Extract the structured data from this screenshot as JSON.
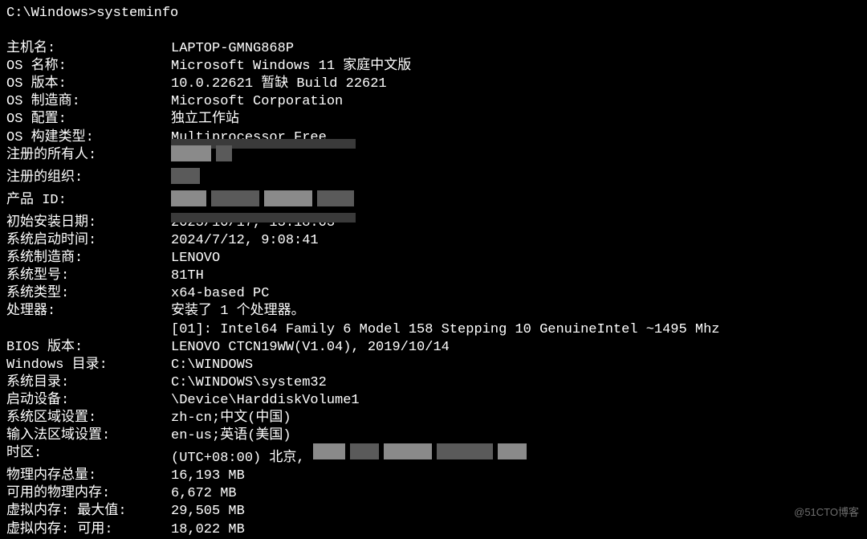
{
  "prompt": "C:\\Windows>systeminfo",
  "rows": [
    {
      "label": "主机名:",
      "value": "LAPTOP-GMNG868P"
    },
    {
      "label": "OS 名称:",
      "value": "Microsoft Windows 11 家庭中文版"
    },
    {
      "label": "OS 版本:",
      "value": "10.0.22621 暂缺 Build 22621"
    },
    {
      "label": "OS 制造商:",
      "value": "Microsoft Corporation"
    },
    {
      "label": "OS 配置:",
      "value": "独立工作站"
    },
    {
      "label": "OS 构建类型:",
      "value": "Multiprocessor Free",
      "overlay": "top-strip"
    },
    {
      "label": "注册的所有人:",
      "value": "",
      "redacted": "owner"
    },
    {
      "label": "注册的组织:",
      "value": "",
      "redacted": "org"
    },
    {
      "label": "产品 ID:",
      "value": "",
      "redacted": "product"
    },
    {
      "label": "初始安装日期:",
      "value": "2023/10/17, 13:18:03",
      "overlay": "bottom-strip"
    },
    {
      "label": "系统启动时间:",
      "value": "2024/7/12, 9:08:41"
    },
    {
      "label": "系统制造商:",
      "value": "LENOVO"
    },
    {
      "label": "系统型号:",
      "value": "81TH"
    },
    {
      "label": "系统类型:",
      "value": "x64-based PC"
    },
    {
      "label": "处理器:",
      "value": "安装了 1 个处理器。"
    },
    {
      "label": "",
      "value": "[01]: Intel64 Family 6 Model 158 Stepping 10 GenuineIntel ~1495 Mhz",
      "indent": true
    },
    {
      "label": "BIOS 版本:",
      "value": "LENOVO CTCN19WW(V1.04), 2019/10/14"
    },
    {
      "label": "Windows 目录:",
      "value": "C:\\WINDOWS"
    },
    {
      "label": "系统目录:",
      "value": "C:\\WINDOWS\\system32"
    },
    {
      "label": "启动设备:",
      "value": "\\Device\\HarddiskVolume1"
    },
    {
      "label": "系统区域设置:",
      "value": "zh-cn;中文(中国)"
    },
    {
      "label": "输入法区域设置:",
      "value": "en-us;英语(美国)"
    },
    {
      "label": "时区:",
      "value": "(UTC+08:00) 北京,",
      "redacted": "tz"
    },
    {
      "label": "物理内存总量:",
      "value": "16,193 MB"
    },
    {
      "label": "可用的物理内存:",
      "value": "6,672 MB"
    },
    {
      "label": "虚拟内存: 最大值:",
      "value": "29,505 MB"
    },
    {
      "label": "虚拟内存: 可用:",
      "value": "18,022 MB"
    }
  ],
  "watermark": "@51CTO博客"
}
